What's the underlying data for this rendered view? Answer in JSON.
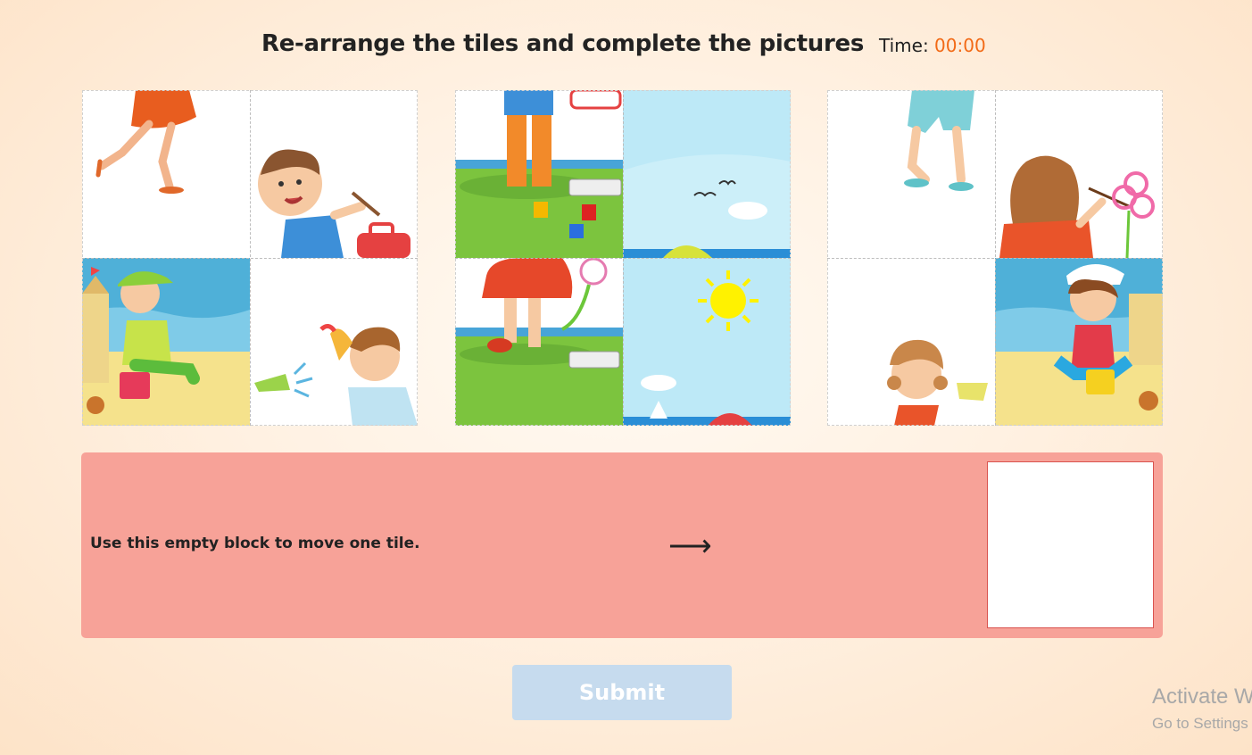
{
  "header": {
    "title": "Re-arrange the tiles and complete the pictures",
    "timer_label": "Time: ",
    "timer_value": "00:00"
  },
  "boards": [
    {
      "tiles": [
        {
          "icon": "running-girl-legs-tile"
        },
        {
          "icon": "boy-painting-tile"
        },
        {
          "icon": "boy-sandcastle-tile"
        },
        {
          "icon": "boy-water-gun-tile"
        }
      ]
    },
    {
      "tiles": [
        {
          "icon": "child-painting-legs-tile"
        },
        {
          "icon": "sky-birds-tile"
        },
        {
          "icon": "girl-red-skirt-tile"
        },
        {
          "icon": "sun-sea-tile"
        }
      ]
    },
    {
      "tiles": [
        {
          "icon": "kid-legs-shorts-tile"
        },
        {
          "icon": "girl-painting-flower-tile"
        },
        {
          "icon": "girl-water-gun-tile"
        },
        {
          "icon": "girl-sandcastle-tile"
        }
      ]
    }
  ],
  "move_panel": {
    "instruction": "Use this empty block to move one tile.",
    "arrow": "⟶"
  },
  "submit_label": "Submit",
  "watermark": {
    "line1": "Activate W",
    "line2": "Go to Settings"
  },
  "colors": {
    "timer": "#f26a16",
    "panel": "#f7a298",
    "submit_disabled": "#c6dbee",
    "empty_slot_border": "#d9534f"
  }
}
